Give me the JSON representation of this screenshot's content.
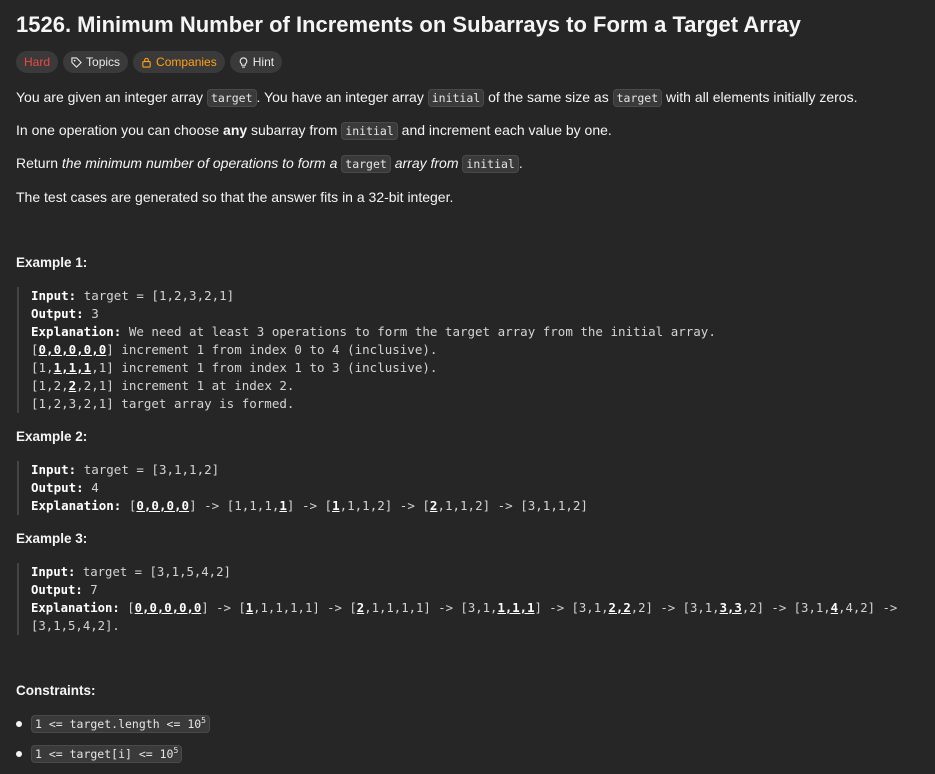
{
  "title": "1526. Minimum Number of Increments on Subarrays to Form a Target Array",
  "badges": {
    "difficulty": "Hard",
    "topics": "Topics",
    "companies": "Companies",
    "hint": "Hint"
  },
  "colors": {
    "hard": "#ef4743",
    "companies": "#ffa116",
    "background": "#262626"
  },
  "description": {
    "p1_a": "You are given an integer array ",
    "p1_code1": "target",
    "p1_b": ". You have an integer array ",
    "p1_code2": "initial",
    "p1_c": " of the same size as ",
    "p1_code3": "target",
    "p1_d": " with all elements initially zeros.",
    "p2_a": "In one operation you can choose ",
    "p2_bold": "any",
    "p2_b": " subarray from ",
    "p2_code": "initial",
    "p2_c": " and increment each value by one.",
    "p3_a": "Return ",
    "p3_em1": "the minimum number of operations to form a ",
    "p3_code1": "target",
    "p3_em2": " array from ",
    "p3_code2": "initial",
    "p3_end": ".",
    "p4": "The test cases are generated so that the answer fits in a 32-bit integer."
  },
  "examples": [
    {
      "heading": "Example 1:",
      "input": "target = [1,2,3,2,1]",
      "output": "3",
      "explanation": "We need at least 3 operations to form the target array from the initial array."
    },
    {
      "heading": "Example 2:",
      "input": "target = [3,1,1,2]",
      "output": "4"
    },
    {
      "heading": "Example 3:",
      "input": "target = [3,1,5,4,2]",
      "output": "7"
    }
  ],
  "labels": {
    "input": "Input:",
    "output": "Output:",
    "explanation": "Explanation:"
  },
  "constraints": {
    "heading": "Constraints:",
    "c1": "1 <= target.length <= 10",
    "c1_sup": "5",
    "c2": "1 <= target[i] <= 10",
    "c2_sup": "5"
  }
}
